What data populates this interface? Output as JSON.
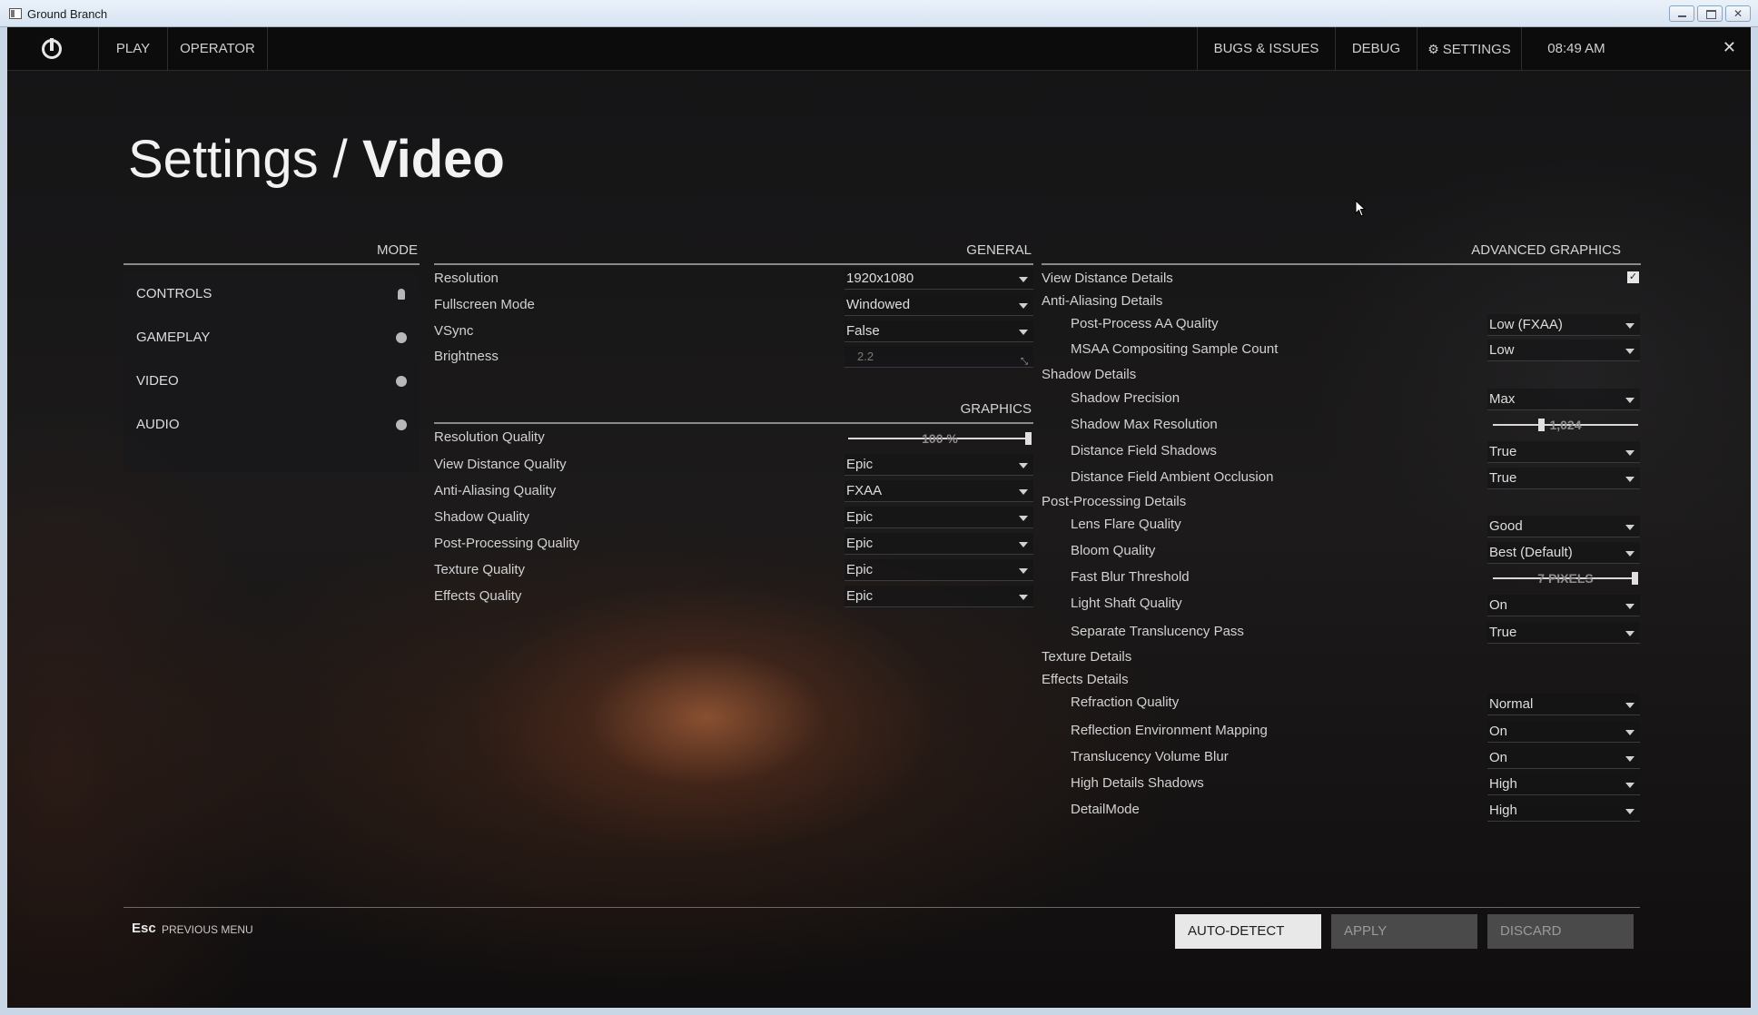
{
  "window": {
    "title": "Ground Branch"
  },
  "topbar": {
    "play": "PLAY",
    "operator": "OPERATOR",
    "bugs": "BUGS & ISSUES",
    "debug": "DEBUG",
    "settings": "SETTINGS",
    "time": "08:49 AM"
  },
  "heading": {
    "prefix": "Settings /",
    "page": "Video"
  },
  "mode": {
    "header": "MODE",
    "items": [
      {
        "label": "CONTROLS"
      },
      {
        "label": "GAMEPLAY"
      },
      {
        "label": "VIDEO"
      },
      {
        "label": "AUDIO"
      }
    ]
  },
  "general": {
    "header": "GENERAL",
    "rows": [
      {
        "label": "Resolution",
        "value": "1920x1080"
      },
      {
        "label": "Fullscreen Mode",
        "value": "Windowed"
      },
      {
        "label": "VSync",
        "value": "False"
      },
      {
        "label": "Brightness",
        "value": "2.2"
      }
    ]
  },
  "graphics": {
    "header": "GRAPHICS",
    "resolution_quality": {
      "label": "Resolution Quality",
      "value_label": "100 %",
      "value": 1.0
    },
    "rows": [
      {
        "label": "View Distance Quality",
        "value": "Epic"
      },
      {
        "label": "Anti-Aliasing Quality",
        "value": "FXAA"
      },
      {
        "label": "Shadow Quality",
        "value": "Epic"
      },
      {
        "label": "Post-Processing Quality",
        "value": "Epic"
      },
      {
        "label": "Texture Quality",
        "value": "Epic"
      },
      {
        "label": "Effects Quality",
        "value": "Epic"
      }
    ]
  },
  "advanced": {
    "header": "ADVANCED GRAPHICS",
    "checked": true,
    "view_distance": "View Distance Details",
    "anti_aliasing": "Anti-Aliasing Details",
    "post_process_aa": {
      "label": "Post-Process AA Quality",
      "value": "Low (FXAA)"
    },
    "msaa": {
      "label": "MSAA Compositing Sample Count",
      "value": "Low"
    },
    "shadow": "Shadow Details",
    "shadow_precision": {
      "label": "Shadow Precision",
      "value": "Max"
    },
    "shadow_max_res": {
      "label": "Shadow Max Resolution",
      "value_label": "1,024",
      "value": 0.33
    },
    "df_shadows": {
      "label": "Distance Field Shadows",
      "value": "True"
    },
    "df_ao": {
      "label": "Distance Field Ambient Occlusion",
      "value": "True"
    },
    "post_processing": "Post-Processing Details",
    "lens_flare": {
      "label": "Lens Flare Quality",
      "value": "Good"
    },
    "bloom": {
      "label": "Bloom Quality",
      "value": "Best (Default)"
    },
    "fast_blur": {
      "label": "Fast Blur Threshold",
      "value_label": "7 PIXELS",
      "value": 1.0
    },
    "light_shaft": {
      "label": "Light Shaft Quality",
      "value": "On"
    },
    "sep_translucency": {
      "label": "Separate Translucency Pass",
      "value": "True"
    },
    "texture": "Texture Details",
    "effects": "Effects Details",
    "refraction": {
      "label": "Refraction Quality",
      "value": "Normal"
    },
    "reflection": {
      "label": "Reflection Environment Mapping",
      "value": "On"
    },
    "translucency_blur": {
      "label": "Translucency Volume Blur",
      "value": "On"
    },
    "high_shadows": {
      "label": "High Details Shadows",
      "value": "High"
    },
    "detail_mode": {
      "label": "DetailMode",
      "value": "High"
    }
  },
  "footer": {
    "esc": "Esc",
    "prev_menu": "PREVIOUS MENU",
    "auto_detect": "AUTO-DETECT",
    "apply": "APPLY",
    "discard": "DISCARD"
  }
}
